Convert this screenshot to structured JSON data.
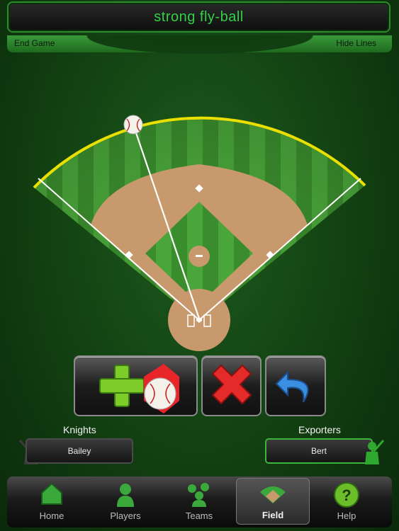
{
  "header": {
    "title": "strong fly-ball"
  },
  "subbar": {
    "left_label": "End Game",
    "right_label": "Hide Lines"
  },
  "toolbar": {
    "add_play_icon": "plus-baseball-icon",
    "delete_icon": "red-x-icon",
    "undo_icon": "undo-arrow-icon"
  },
  "teams": {
    "away": {
      "name": "Knights",
      "player": "Bailey",
      "active": false
    },
    "home": {
      "name": "Exporters",
      "player": "Bert",
      "active": true
    }
  },
  "tabs": [
    {
      "label": "Home",
      "icon": "home-icon"
    },
    {
      "label": "Players",
      "icon": "player-icon"
    },
    {
      "label": "Teams",
      "icon": "team-icon"
    },
    {
      "label": "Field",
      "icon": "field-icon",
      "active": true
    },
    {
      "label": "Help",
      "icon": "help-icon"
    }
  ],
  "colors": {
    "accent": "#34d04a",
    "grass": "#3c9a2e",
    "dirt": "#c79a6c",
    "foul_line": "#f2e600"
  }
}
